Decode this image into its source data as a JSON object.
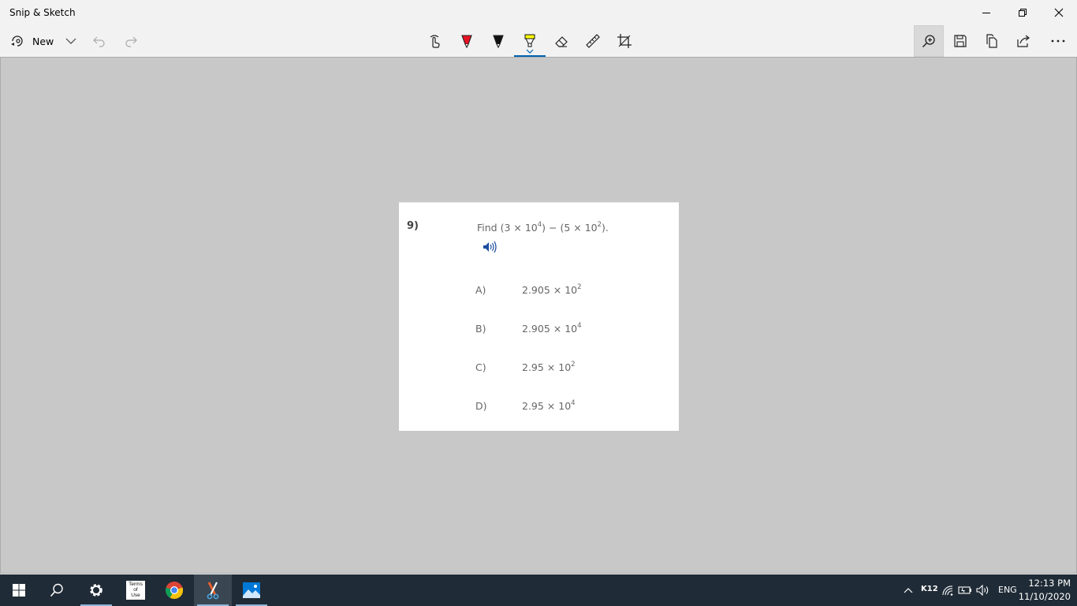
{
  "window": {
    "title": "Snip & Sketch"
  },
  "toolbar": {
    "new_label": "New",
    "tools": [
      "touch-writing-icon",
      "ballpoint-pen-icon",
      "pencil-icon",
      "highlighter-icon",
      "eraser-icon",
      "ruler-icon",
      "crop-icon"
    ],
    "active_tool": "highlighter-icon",
    "right_tools": [
      "zoom-icon",
      "save-icon",
      "copy-icon",
      "share-icon",
      "more-icon"
    ]
  },
  "question": {
    "number": "9)",
    "prompt_pre": "Find (3 × 10",
    "prompt_exp1": "4",
    "prompt_mid": ") − (5 × 10",
    "prompt_exp2": "2",
    "prompt_post": ").",
    "options": [
      {
        "letter": "A)",
        "mantissa": "2.905 × 10",
        "exponent": "2"
      },
      {
        "letter": "B)",
        "mantissa": "2.905 × 10",
        "exponent": "4"
      },
      {
        "letter": "C)",
        "mantissa": "2.95 × 10",
        "exponent": "2"
      },
      {
        "letter": "D)",
        "mantissa": "2.95 × 10",
        "exponent": "4"
      }
    ]
  },
  "taskbar": {
    "apps": [
      "start-icon",
      "search-icon",
      "settings-icon",
      "terms-of-use-icon",
      "chrome-icon",
      "snip-sketch-icon",
      "photos-icon"
    ],
    "terms_label_1": "Terms",
    "terms_label_2": "of",
    "terms_label_3": "Use",
    "tray_k12": "K12",
    "language": "ENG",
    "time": "12:13 PM",
    "date": "11/10/2020"
  },
  "colors": {
    "accent": "#0063b1",
    "canvas_bg": "#c8c8c8",
    "taskbar_bg": "#1f2b36",
    "pen_red": "#e81123",
    "highlighter_yellow": "#ffff00"
  }
}
